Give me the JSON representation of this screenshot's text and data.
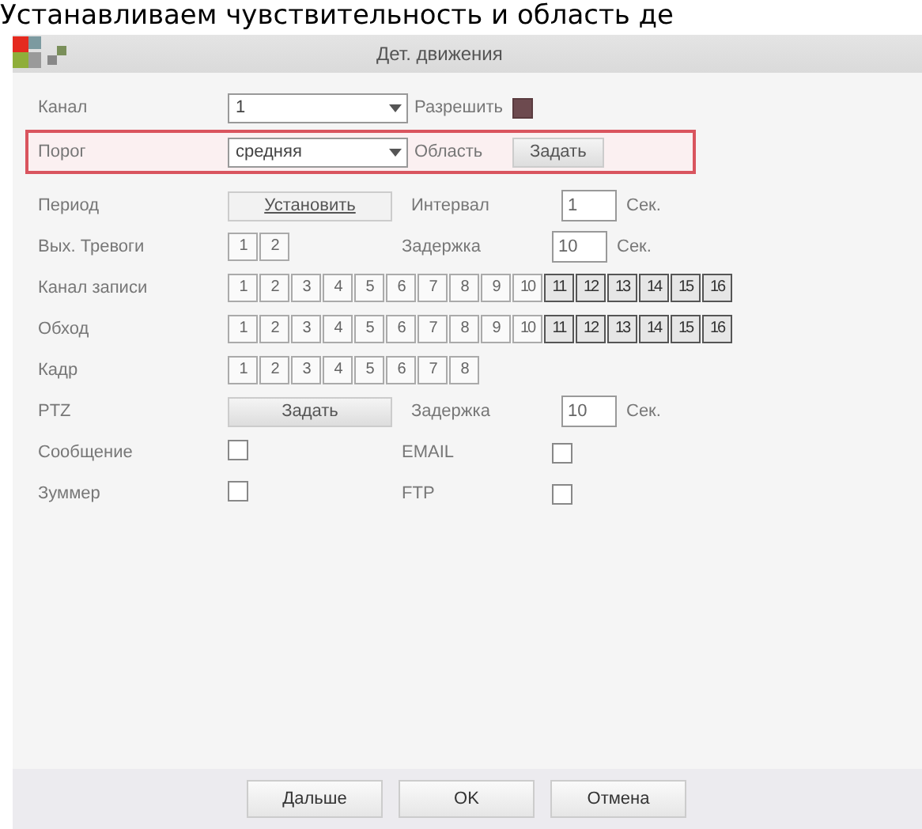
{
  "caption": "Устанавливаем чувствительность и область де",
  "window": {
    "title": "Дет. движения"
  },
  "channel": {
    "label": "Канал",
    "value": "1"
  },
  "enable": {
    "label": "Разрешить",
    "checked": true
  },
  "threshold": {
    "label": "Порог",
    "value": "средняя"
  },
  "area": {
    "label": "Область",
    "button": "Задать"
  },
  "period": {
    "label": "Период",
    "button": "Установить"
  },
  "interval": {
    "label": "Интервал",
    "value": "1",
    "unit": "Сек."
  },
  "alarm_out": {
    "label": "Вых. Тревоги",
    "boxes": [
      {
        "label": "1",
        "selected": false
      },
      {
        "label": "2",
        "selected": false
      }
    ]
  },
  "delay": {
    "label": "Задержка",
    "value": "10",
    "unit": "Сек."
  },
  "record_channel": {
    "label": "Канал записи",
    "boxes": [
      {
        "label": "1",
        "selected": false
      },
      {
        "label": "2",
        "selected": false
      },
      {
        "label": "3",
        "selected": false
      },
      {
        "label": "4",
        "selected": false
      },
      {
        "label": "5",
        "selected": false
      },
      {
        "label": "6",
        "selected": false
      },
      {
        "label": "7",
        "selected": false
      },
      {
        "label": "8",
        "selected": false
      },
      {
        "label": "9",
        "selected": false
      },
      {
        "label": "10",
        "selected": false
      },
      {
        "label": "11",
        "selected": true
      },
      {
        "label": "12",
        "selected": true
      },
      {
        "label": "13",
        "selected": true
      },
      {
        "label": "14",
        "selected": true
      },
      {
        "label": "15",
        "selected": true
      },
      {
        "label": "16",
        "selected": true
      }
    ]
  },
  "tour": {
    "label": "Обход",
    "boxes": [
      {
        "label": "1",
        "selected": false
      },
      {
        "label": "2",
        "selected": false
      },
      {
        "label": "3",
        "selected": false
      },
      {
        "label": "4",
        "selected": false
      },
      {
        "label": "5",
        "selected": false
      },
      {
        "label": "6",
        "selected": false
      },
      {
        "label": "7",
        "selected": false
      },
      {
        "label": "8",
        "selected": false
      },
      {
        "label": "9",
        "selected": false
      },
      {
        "label": "10",
        "selected": false
      },
      {
        "label": "11",
        "selected": true
      },
      {
        "label": "12",
        "selected": true
      },
      {
        "label": "13",
        "selected": true
      },
      {
        "label": "14",
        "selected": true
      },
      {
        "label": "15",
        "selected": true
      },
      {
        "label": "16",
        "selected": true
      }
    ]
  },
  "snapshot": {
    "label": "Кадр",
    "boxes": [
      {
        "label": "1",
        "selected": false
      },
      {
        "label": "2",
        "selected": false
      },
      {
        "label": "3",
        "selected": false
      },
      {
        "label": "4",
        "selected": false
      },
      {
        "label": "5",
        "selected": false
      },
      {
        "label": "6",
        "selected": false
      },
      {
        "label": "7",
        "selected": false
      },
      {
        "label": "8",
        "selected": false
      }
    ]
  },
  "ptz": {
    "label": "PTZ",
    "button": "Задать"
  },
  "ptz_delay": {
    "label": "Задержка",
    "value": "10",
    "unit": "Сек."
  },
  "message": {
    "label": "Сообщение",
    "checked": false
  },
  "email": {
    "label": "EMAIL",
    "checked": false
  },
  "buzzer": {
    "label": "Зуммер",
    "checked": false
  },
  "ftp": {
    "label": "FTP",
    "checked": false
  },
  "buttons": [
    "Дальше",
    "OK",
    "Отмена"
  ]
}
